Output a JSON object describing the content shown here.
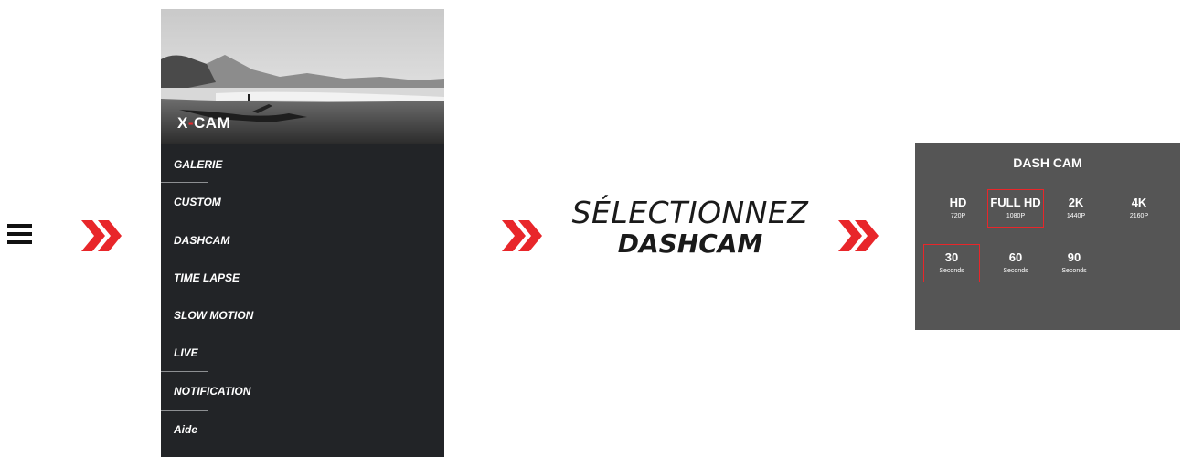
{
  "hamburger": {
    "icon": "hamburger-menu-icon"
  },
  "chevron_icon": "double-chevron-right-icon",
  "colors": {
    "accent": "#e8262a",
    "menu_bg": "#222427",
    "panel_bg": "#555555"
  },
  "menu": {
    "brand_prefix": "X",
    "brand_suffix": "CAM",
    "items": [
      {
        "label": "GALERIE"
      },
      {
        "label": "CUSTOM"
      },
      {
        "label": "DASHCAM"
      },
      {
        "label": "TIME LAPSE"
      },
      {
        "label": "SLOW MOTION"
      },
      {
        "label": "LIVE"
      },
      {
        "label": "NOTIFICATION"
      },
      {
        "label": "Aide"
      }
    ]
  },
  "instruction": {
    "line1": "SÉLECTIONNEZ",
    "line2": "DASHCAM"
  },
  "dashcam_panel": {
    "title": "DASH CAM",
    "resolutions": [
      {
        "label": "HD",
        "sub": "720P"
      },
      {
        "label": "FULL HD",
        "sub": "1080P",
        "selected": true
      },
      {
        "label": "2K",
        "sub": "1440P"
      },
      {
        "label": "4K",
        "sub": "2160P"
      }
    ],
    "durations": [
      {
        "label": "30",
        "sub": "Seconds",
        "selected": true
      },
      {
        "label": "60",
        "sub": "Seconds"
      },
      {
        "label": "90",
        "sub": "Seconds"
      }
    ]
  }
}
